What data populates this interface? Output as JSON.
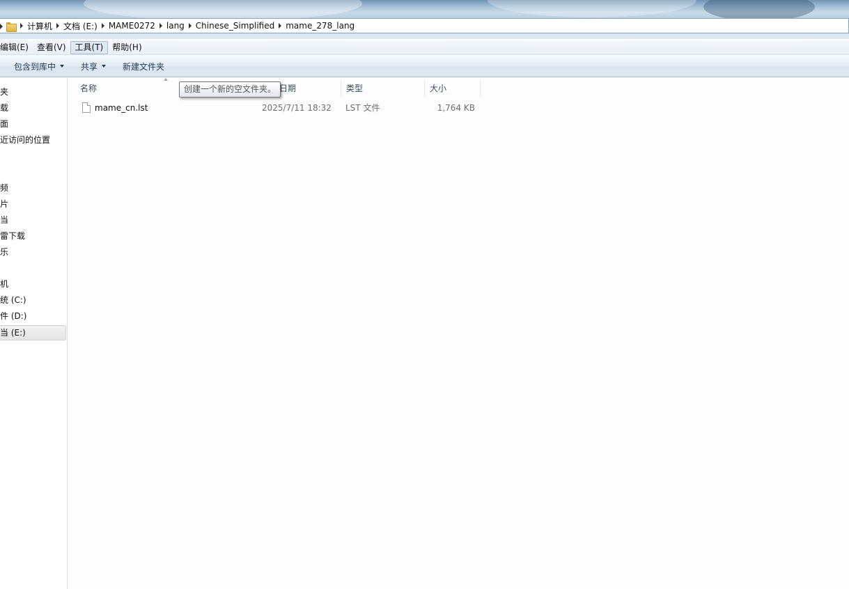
{
  "address_bar": {
    "crumbs": [
      "计算机",
      "文档 (E:)",
      "MAME0272",
      "lang",
      "Chinese_Simplified",
      "mame_278_lang"
    ]
  },
  "menu": {
    "items": [
      "编辑(E)",
      "查看(V)",
      "工具(T)",
      "帮助(H)"
    ],
    "active_index": 2
  },
  "toolbar": {
    "include_library": "包含到库中",
    "share": "共享",
    "new_folder": "新建文件夹"
  },
  "nav": {
    "items": [
      "夹",
      "载",
      "面",
      "近访问的位置",
      "频",
      "片",
      "当",
      "雷下载",
      "乐",
      "机",
      "统 (C:)",
      "件 (D:)",
      "当 (E:)"
    ],
    "selected_index": 12
  },
  "columns": {
    "name": "名称",
    "date": "修改日期",
    "type": "类型",
    "size": "大小"
  },
  "files": [
    {
      "name": "mame_cn.lst",
      "date": "2025/7/11 18:32",
      "type": "LST 文件",
      "size": "1,764 KB"
    }
  ],
  "tooltip": {
    "text": "创建一个新的空文件夹。"
  },
  "colors": {
    "command_text": "#1e395b",
    "secondary_text": "#6d6d6d"
  }
}
